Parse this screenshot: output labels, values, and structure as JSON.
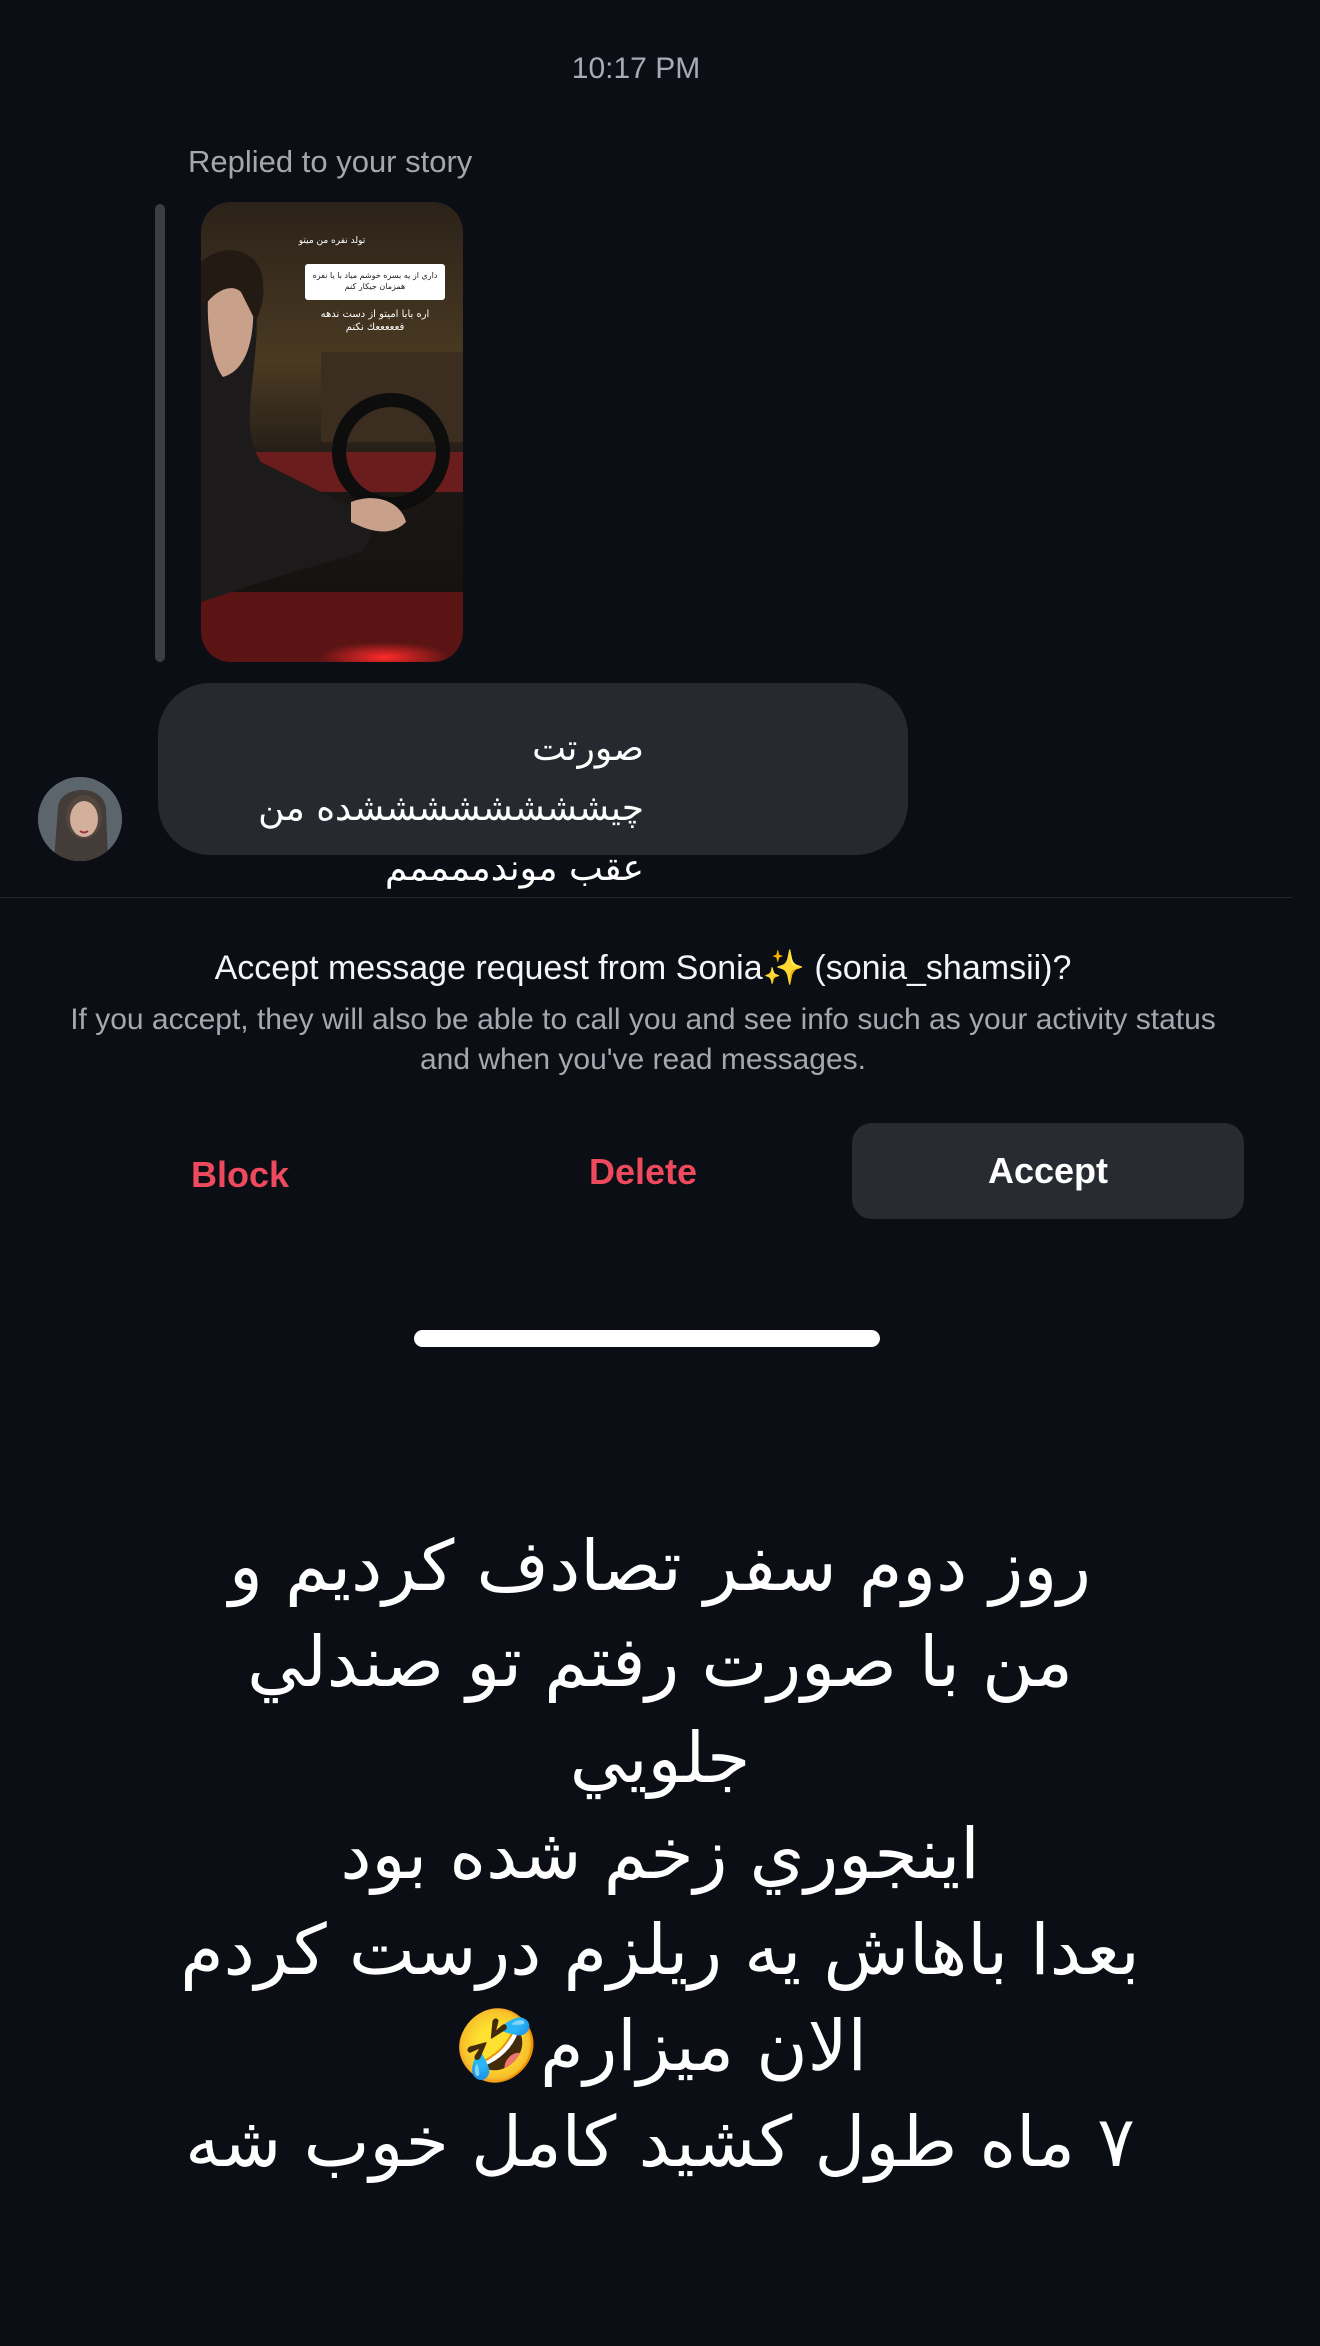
{
  "header": {
    "timestamp": "10:17 PM"
  },
  "story_reply": {
    "label": "Replied to your story",
    "story_header": "تولد نفره من ميتو",
    "story_question": "داري از يه بسره خوشم مياد با يا نفره همزمان جيكار كنم",
    "story_answer": "اره بابا اميتو از دست ندهه فعععععك نكنم"
  },
  "message": {
    "text": "صورتت چيششششششششده من عقب موندممممم"
  },
  "request": {
    "title": "Accept message request from Sonia✨ (sonia_shamsii)?",
    "description": "If you accept, they will also be able to call you and see info such as your activity status and when you've read messages.",
    "block_label": "Block",
    "delete_label": "Delete",
    "accept_label": "Accept",
    "accent_color": "#ee4a5d"
  },
  "caption": {
    "lines": [
      "روز دوم سفر تصادف كرديم و",
      "من با صورت رفتم تو صندلي",
      "جلويي",
      "اينجوري زخم شده بود",
      "بعدا باهاش يه ريلزم درست كردم",
      "الان ميزارم🤣",
      "۷ ماه طول كشيد كامل خوب شه"
    ]
  }
}
